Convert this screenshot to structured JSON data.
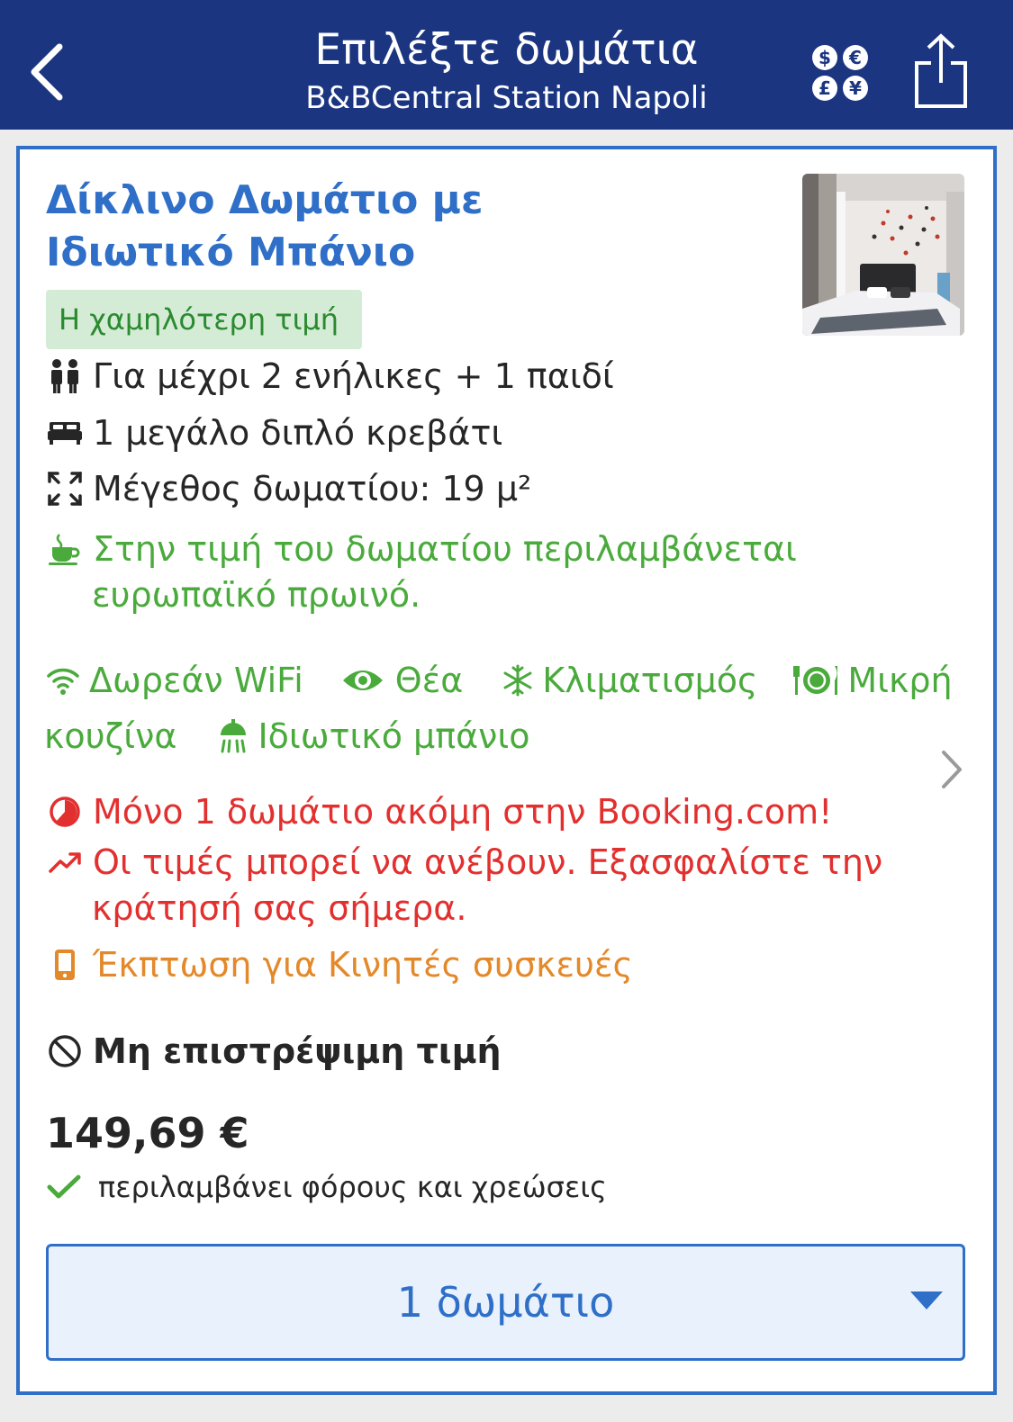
{
  "header": {
    "title": "Επιλέξτε δωμάτια",
    "subtitle": "B&BCentral Station Napoli"
  },
  "room": {
    "title_line1": "Δίκλινο Δωμάτιο με",
    "title_line2": "Ιδιωτικό Μπάνιο",
    "badge": "Η χαμηλότερη τιμή",
    "occupancy": "Για μέχρι 2 ενήλικες + 1 παιδί",
    "bed": "1 μεγάλο διπλό κρεβάτι",
    "size": "Μέγεθος δωματίου: 19 μ²",
    "breakfast_line1": "Στην τιμή του δωματίου περιλαμβάνεται",
    "breakfast_line2": "ευρωπαϊκό πρωινό.",
    "facilities": {
      "wifi": "Δωρεάν WiFi",
      "view": "Θέα",
      "ac": "Κλιματισμός",
      "kitchen_part1": "Μικρή",
      "kitchen_part2": "κουζίνα",
      "bathroom": "Ιδιωτικό μπάνιο"
    },
    "scarcity": "Μόνο 1 δωμάτιο ακόμη στην Booking.com!",
    "price_rise_line1": "Οι τιμές μπορεί να ανέβουν. Εξασφαλίστε την",
    "price_rise_line2": "κράτησή σας σήμερα.",
    "mobile_discount": "Έκπτωση για Κινητές συσκευές",
    "policy": "Μη επιστρέψιμη τιμή",
    "price": "149,69 €",
    "taxes_note": "περιλαμβάνει φόρους και χρεώσεις",
    "room_select": "1 δωμάτιο"
  },
  "colors": {
    "navbar": "#1b3580",
    "accent_blue": "#2f6fc8",
    "green": "#4aaa3c",
    "red": "#e2302f",
    "orange": "#e3892a",
    "badge_bg": "#d4ecd6"
  },
  "icons": {
    "back": "chevron-left-icon",
    "currency": "currency-icon",
    "share": "share-icon",
    "occupancy": "people-icon",
    "bed": "bed-icon",
    "size": "expand-icon",
    "breakfast": "coffee-cup-icon",
    "wifi": "wifi-icon",
    "view": "eye-icon",
    "ac": "snowflake-icon",
    "kitchen": "plate-cutlery-icon",
    "bathroom": "shower-icon",
    "scarcity": "pie-clock-icon",
    "trend": "trend-up-icon",
    "mobile": "mobile-phone-icon",
    "policy": "no-symbol-icon",
    "check": "checkmark-icon",
    "caret": "caret-down-icon",
    "next": "chevron-right-icon"
  }
}
